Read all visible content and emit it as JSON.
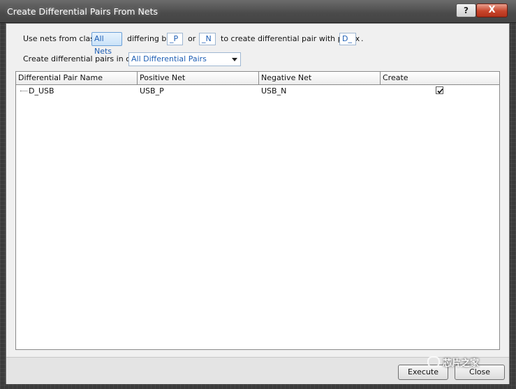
{
  "window": {
    "title": "Create Differential Pairs From Nets",
    "help_glyph": "?",
    "close_glyph": "X"
  },
  "options": {
    "use_nets_label": "Use nets from class",
    "class_value": "All Nets",
    "differing_label": "differing by",
    "positive_suffix": "_P",
    "or_label": "or",
    "negative_suffix": "_N",
    "prefix_label": "to create differential pair with prefix",
    "prefix_value": "D_",
    "trailing_dot": ".",
    "pairs_class_label": "Create differential pairs in class",
    "pairs_class_value": "All Differential Pairs"
  },
  "table": {
    "columns": [
      "Differential Pair Name",
      "Positive Net",
      "Negative Net",
      "Create"
    ],
    "rows": [
      {
        "name": "D_USB",
        "positive": "USB_P",
        "negative": "USB_N",
        "create": true
      }
    ]
  },
  "buttons": {
    "execute": "Execute",
    "close": "Close"
  },
  "watermark": "芯片之家"
}
